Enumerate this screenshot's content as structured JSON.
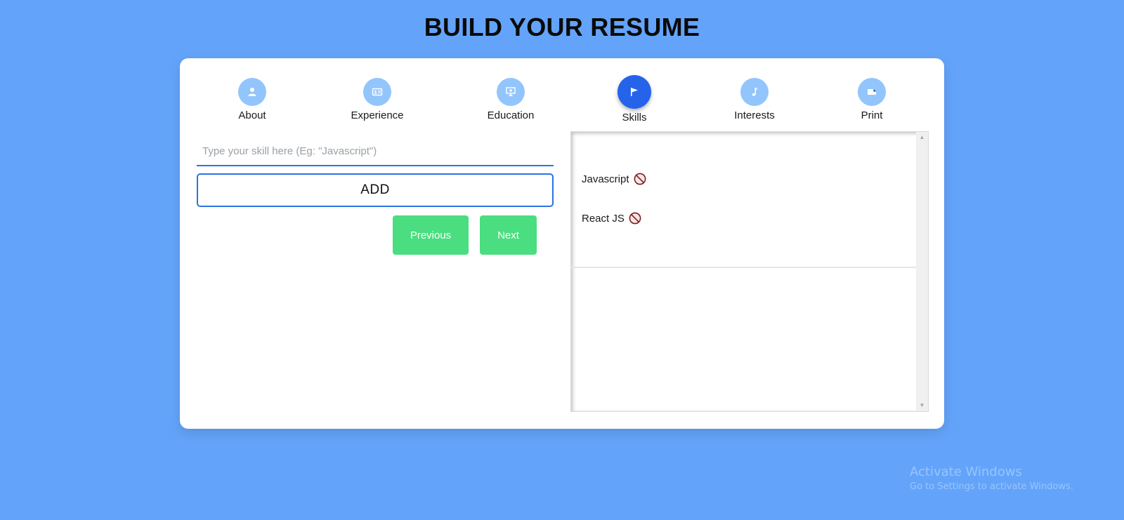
{
  "page": {
    "title": "BUILD YOUR RESUME"
  },
  "steps": [
    {
      "label": "About",
      "icon": "user-icon",
      "active": false
    },
    {
      "label": "Experience",
      "icon": "id-card-icon",
      "active": false
    },
    {
      "label": "Education",
      "icon": "graduation-icon",
      "active": false
    },
    {
      "label": "Skills",
      "icon": "flag-icon",
      "active": true
    },
    {
      "label": "Interests",
      "icon": "music-note-icon",
      "active": false
    },
    {
      "label": "Print",
      "icon": "file-icon",
      "active": false
    }
  ],
  "form": {
    "skill_value": "",
    "skill_placeholder": "Type your skill here (Eg: \"Javascript\")",
    "add_label": "ADD",
    "previous_label": "Previous",
    "next_label": "Next"
  },
  "preview": {
    "skills": [
      "Javascript",
      "React JS"
    ],
    "remove_icon": "prohibited-icon"
  },
  "watermark": {
    "line1": "Activate Windows",
    "line2": "Go to Settings to activate Windows."
  },
  "colors": {
    "background": "#63a4fa",
    "step_inactive": "#93c5fd",
    "step_active": "#2563eb",
    "accent_border": "#2b74e4",
    "nav_button": "#4ade80"
  }
}
